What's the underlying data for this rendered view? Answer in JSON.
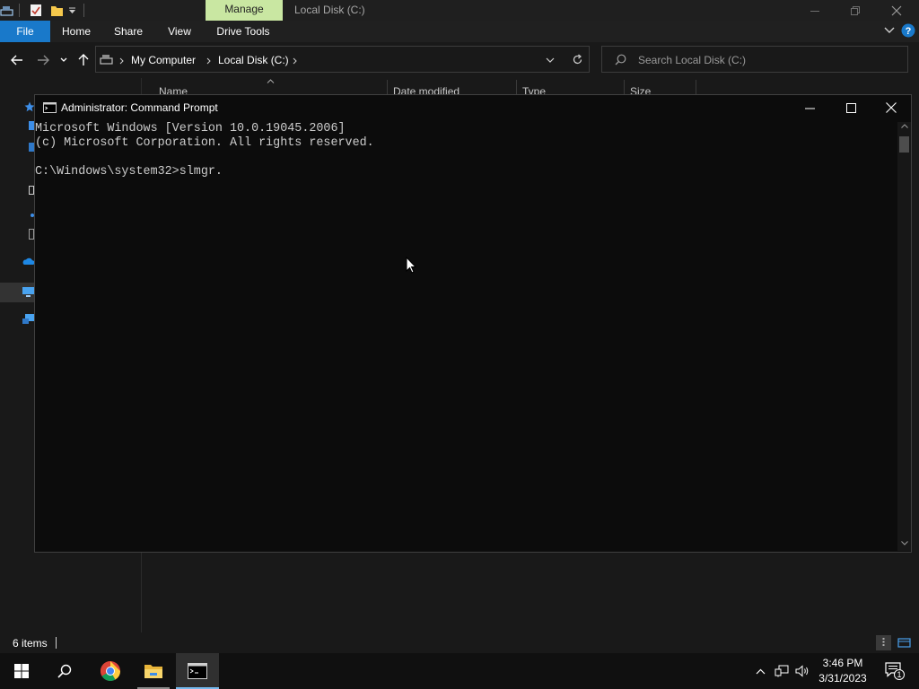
{
  "explorer": {
    "context_tab": "Manage",
    "window_title": "Local Disk (C:)",
    "ribbon_tabs": [
      "File",
      "Home",
      "Share",
      "View",
      "Drive Tools"
    ],
    "breadcrumb": [
      "My Computer",
      "Local Disk (C:)"
    ],
    "search_placeholder": "Search Local Disk (C:)",
    "columns": [
      "Name",
      "Date modified",
      "Type",
      "Size"
    ],
    "status_text": "6 items"
  },
  "cmd": {
    "title": "Administrator:  Command Prompt",
    "lines": [
      "Microsoft Windows [Version 10.0.19045.2006]",
      "(c) Microsoft Corporation. All rights reserved.",
      "",
      "C:\\Windows\\system32>slmgr."
    ]
  },
  "taskbar": {
    "time": "3:46 PM",
    "date": "3/31/2023",
    "notification_count": "1"
  },
  "colors": {
    "file_tab": "#1979ca",
    "manage_tab": "#c9e7a2",
    "console_bg": "#0c0c0c",
    "console_text": "#cccccc",
    "taskbar_bg": "#101010"
  }
}
